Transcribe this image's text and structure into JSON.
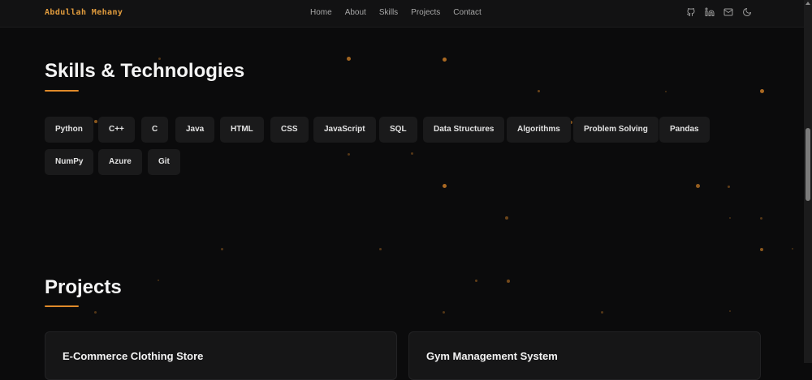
{
  "nav": {
    "brand": "Abdullah Mehany",
    "links": [
      "Home",
      "About",
      "Skills",
      "Projects",
      "Contact"
    ],
    "icons": [
      "github-icon",
      "linkedin-icon",
      "mail-icon",
      "moon-icon"
    ]
  },
  "skills": {
    "title": "Skills & Technologies",
    "items": [
      "Python",
      "C++",
      "C",
      "Java",
      "HTML",
      "CSS",
      "JavaScript",
      "SQL",
      "Data Structures",
      "Algorithms",
      "Problem Solving",
      "Pandas",
      "NumPy",
      "Azure",
      "Git"
    ]
  },
  "projects": {
    "title": "Projects",
    "cards": [
      {
        "title": "E-Commerce Clothing Store"
      },
      {
        "title": "Gym Management System"
      }
    ]
  },
  "colors": {
    "accent": "#e08a2a",
    "background": "#0b0b0c",
    "chip": "#1a1a1b"
  }
}
